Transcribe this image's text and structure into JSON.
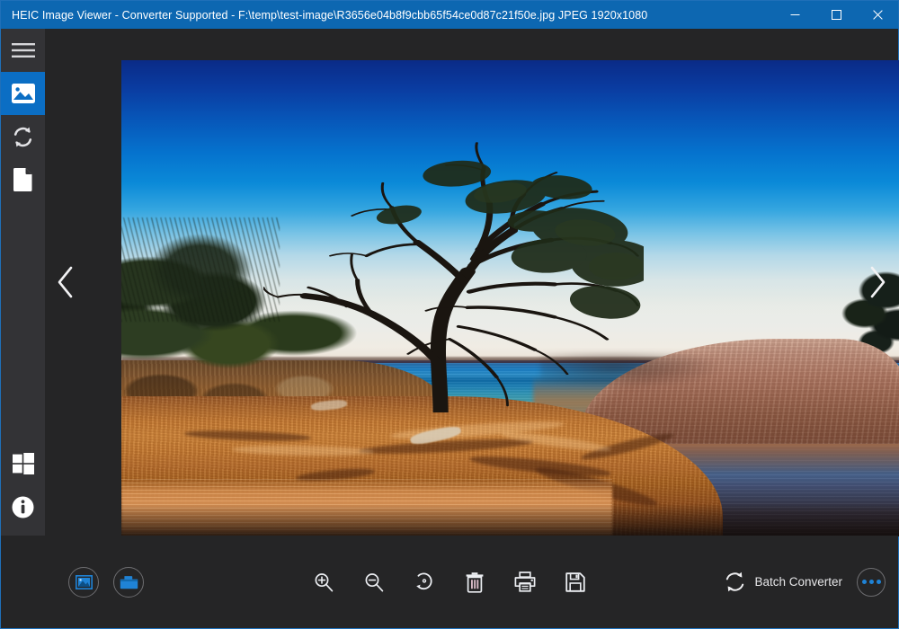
{
  "window": {
    "title": "HEIC Image Viewer - Converter Supported - F:\\temp\\test-image\\R3656e04b8f9cbb65f54ce0d87c21f50e.jpg JPEG 1920x1080",
    "app_name": "HEIC Image Viewer",
    "subtitle": "Converter Supported",
    "file_path": "F:\\temp\\test-image\\R3656e04b8f9cbb65f54ce0d87c21f50e.jpg",
    "file_format": "JPEG",
    "dimensions": "1920x1080",
    "titlebar_color": "#0d67b1",
    "controls": {
      "minimize": "minimize-icon",
      "maximize": "maximize-icon",
      "close": "close-icon"
    }
  },
  "sidebar": {
    "background": "#333336",
    "accent": "#0b6ec4",
    "items": [
      {
        "name": "menu",
        "label": "Menu",
        "icon": "hamburger-icon",
        "active": false
      },
      {
        "name": "image",
        "label": "Image Viewer",
        "icon": "image-icon",
        "active": true
      },
      {
        "name": "convert",
        "label": "Convert",
        "icon": "refresh-icon",
        "active": false
      },
      {
        "name": "document",
        "label": "Document",
        "icon": "document-icon",
        "active": false
      }
    ],
    "bottom_items": [
      {
        "name": "windows-store",
        "label": "Windows Store",
        "icon": "windows-icon"
      },
      {
        "name": "about",
        "label": "About",
        "icon": "info-icon"
      }
    ]
  },
  "viewer": {
    "background": "#252526",
    "prev_label": "Previous image",
    "next_label": "Next image",
    "prev_icon": "chevron-left-icon",
    "next_icon": "chevron-right-icon",
    "image_alt": "Coastal landscape with silhouetted tree, orange granite rocks and long-exposure blue sea"
  },
  "toolbar": {
    "background": "#252526",
    "open_image_label": "Open Image",
    "open_image_icon": "picture-icon",
    "open_folder_label": "Open Folder",
    "open_folder_icon": "folder-icon",
    "tools": [
      {
        "name": "zoom-in",
        "label": "Zoom In",
        "icon": "zoom-in-icon"
      },
      {
        "name": "zoom-out",
        "label": "Zoom Out",
        "icon": "zoom-out-icon"
      },
      {
        "name": "rotate",
        "label": "Rotate",
        "icon": "rotate-icon"
      },
      {
        "name": "delete",
        "label": "Delete",
        "icon": "trash-icon"
      },
      {
        "name": "print",
        "label": "Print",
        "icon": "print-icon"
      },
      {
        "name": "save",
        "label": "Save",
        "icon": "save-icon"
      }
    ],
    "batch_converter_label": "Batch Converter",
    "batch_converter_icon": "sync-icon",
    "more_label": "More options",
    "more_icon": "ellipsis-icon",
    "accent": "#1f83d6"
  }
}
